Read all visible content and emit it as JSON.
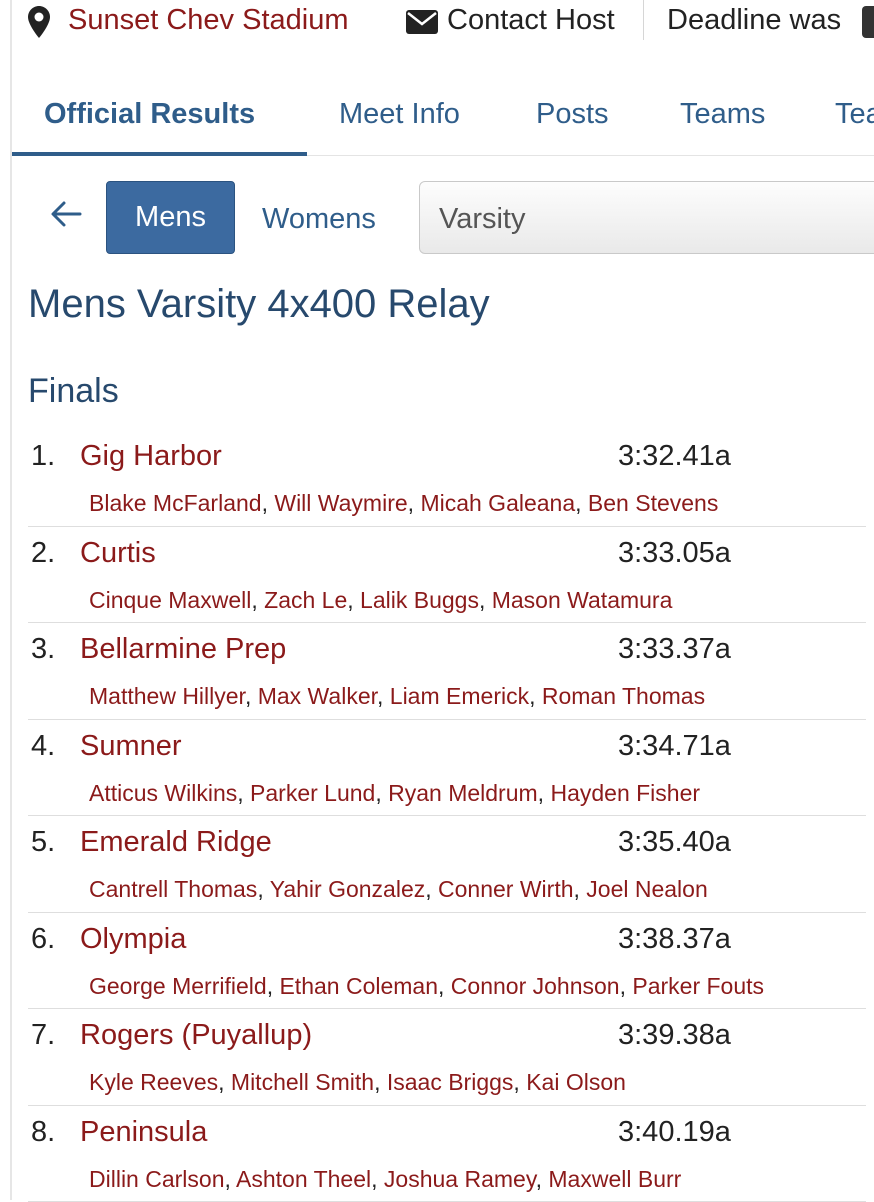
{
  "header": {
    "venue": "Sunset Chev Stadium",
    "contact_label": "Contact Host",
    "deadline_text": "Deadline was"
  },
  "tabs": [
    {
      "label": "Official Results",
      "active": true
    },
    {
      "label": "Meet Info"
    },
    {
      "label": "Posts"
    },
    {
      "label": "Teams"
    },
    {
      "label": "Tea"
    }
  ],
  "filters": {
    "back_icon": "arrow-left-icon",
    "gender_selected": "Mens",
    "gender_other": "Womens",
    "level_select_value": "Varsity"
  },
  "event_title": "Mens Varsity 4x400 Relay",
  "round": "Finals",
  "colors": {
    "accent": "#2f5d8a",
    "button": "#3c6aa0",
    "team_link": "#8b1a1a",
    "title": "#27496d"
  },
  "results": [
    {
      "place": "1.",
      "team": "Gig Harbor",
      "time": "3:32.41a",
      "athletes": [
        "Blake McFarland",
        "Will Waymire",
        "Micah Galeana",
        "Ben Stevens"
      ]
    },
    {
      "place": "2.",
      "team": "Curtis",
      "time": "3:33.05a",
      "athletes": [
        "Cinque Maxwell",
        "Zach Le",
        "Lalik Buggs",
        "Mason Watamura"
      ]
    },
    {
      "place": "3.",
      "team": "Bellarmine Prep",
      "time": "3:33.37a",
      "athletes": [
        "Matthew Hillyer",
        "Max Walker",
        "Liam Emerick",
        "Roman Thomas"
      ]
    },
    {
      "place": "4.",
      "team": "Sumner",
      "time": "3:34.71a",
      "athletes": [
        "Atticus Wilkins",
        "Parker Lund",
        "Ryan Meldrum",
        "Hayden Fisher"
      ]
    },
    {
      "place": "5.",
      "team": "Emerald Ridge",
      "time": "3:35.40a",
      "athletes": [
        "Cantrell Thomas",
        "Yahir Gonzalez",
        "Conner Wirth",
        "Joel Nealon"
      ]
    },
    {
      "place": "6.",
      "team": "Olympia",
      "time": "3:38.37a",
      "athletes": [
        "George Merrifield",
        "Ethan Coleman",
        "Connor Johnson",
        "Parker Fouts"
      ]
    },
    {
      "place": "7.",
      "team": "Rogers (Puyallup)",
      "time": "3:39.38a",
      "athletes": [
        "Kyle Reeves",
        "Mitchell Smith",
        "Isaac Briggs",
        "Kai Olson"
      ]
    },
    {
      "place": "8.",
      "team": "Peninsula",
      "time": "3:40.19a",
      "athletes": [
        "Dillin Carlson",
        "Ashton Theel",
        "Joshua Ramey",
        "Maxwell Burr"
      ]
    }
  ]
}
